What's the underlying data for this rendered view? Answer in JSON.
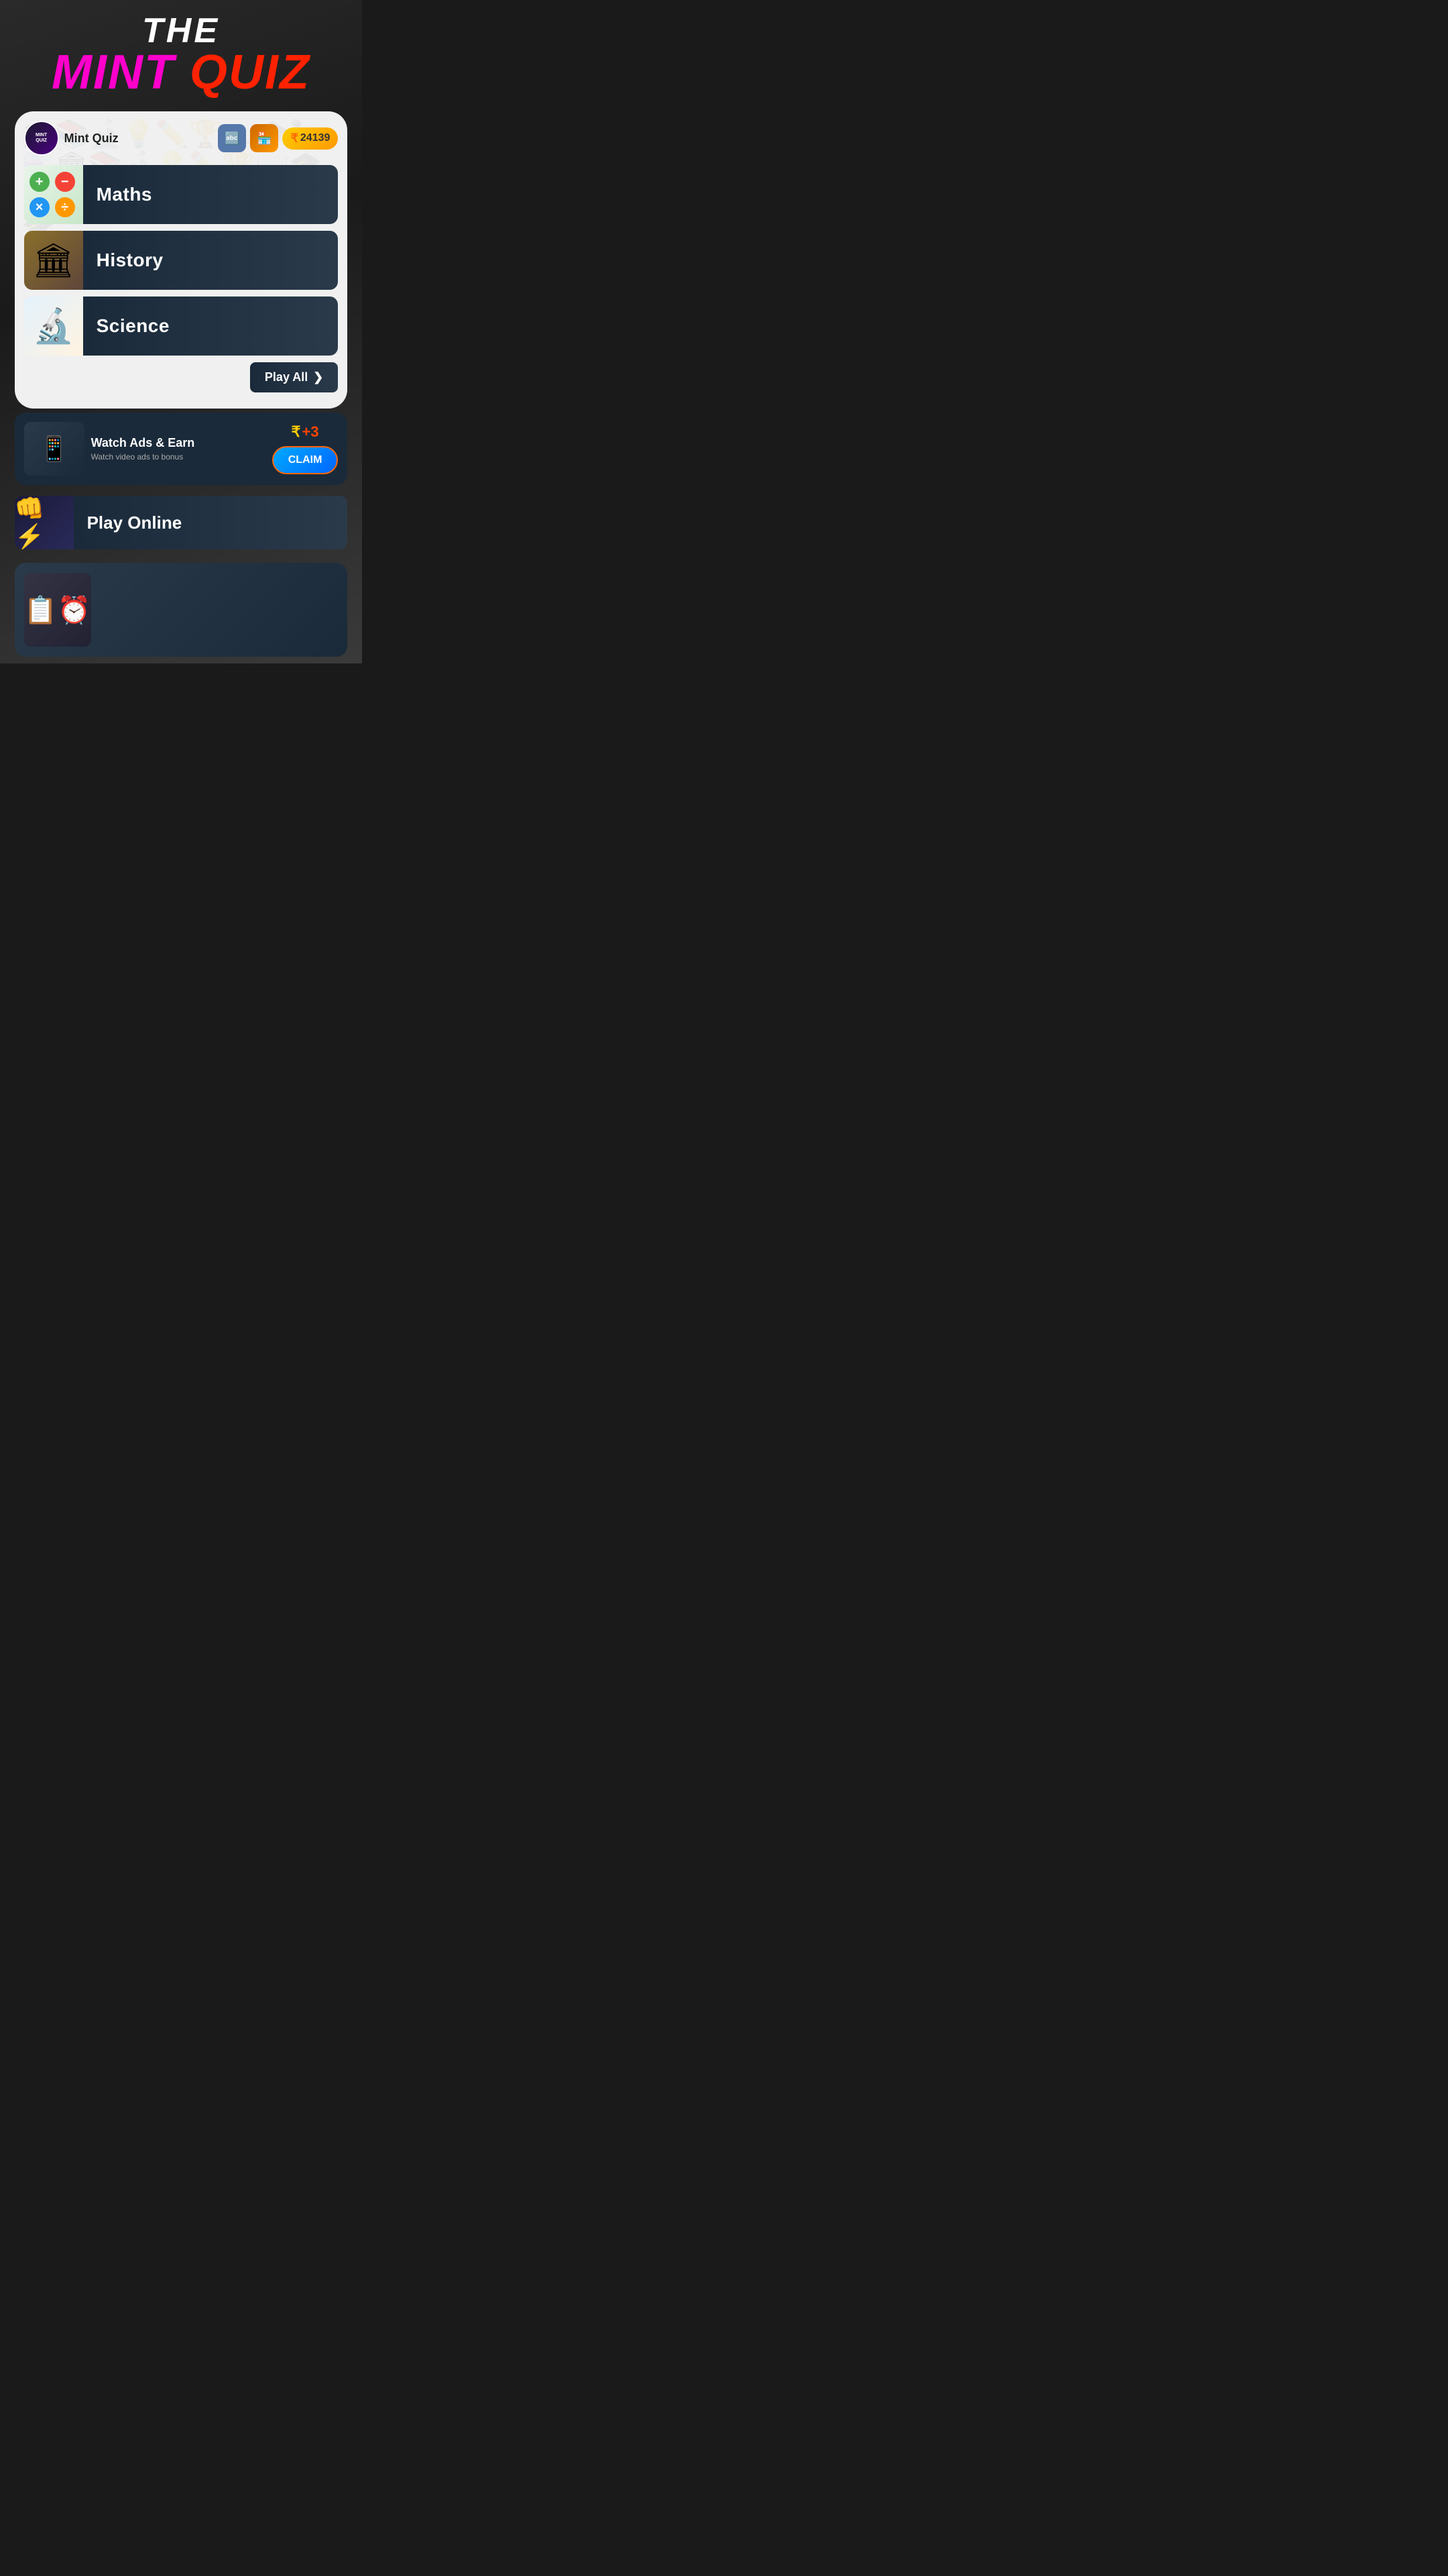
{
  "app": {
    "title_the": "THE",
    "title_mint": "MINT",
    "title_quiz": "QUIZ",
    "name": "Mint Quiz",
    "coin_amount": "24139"
  },
  "toolbar": {
    "translate_icon": "🔤",
    "store_icon": "🏪",
    "coin_icon": "₹"
  },
  "categories": [
    {
      "id": "maths",
      "label": "Maths",
      "thumb_type": "math_ops"
    },
    {
      "id": "history",
      "label": "History",
      "thumb_emoji": "🏛"
    },
    {
      "id": "science",
      "label": "Science",
      "thumb_emoji": "🔬"
    }
  ],
  "play_all": {
    "label": "Play All",
    "arrow": "❯"
  },
  "ads_section": {
    "title": "Watch Ads & Earn",
    "subtitle": "Watch video ads to bonus",
    "earn_prefix": "₹",
    "earn_amount": "+3",
    "claim_label": "CLAIM"
  },
  "play_online": {
    "label": "Play Online",
    "thumb_emoji": "👊"
  },
  "bottom_card": {
    "thumb_emoji": "📋⏰"
  },
  "watermark": {
    "icons": [
      "🏛",
      "📚",
      "🔬",
      "💡",
      "✏️",
      "🏆",
      "📖",
      "🎓",
      "🔭",
      "⚗️"
    ]
  }
}
